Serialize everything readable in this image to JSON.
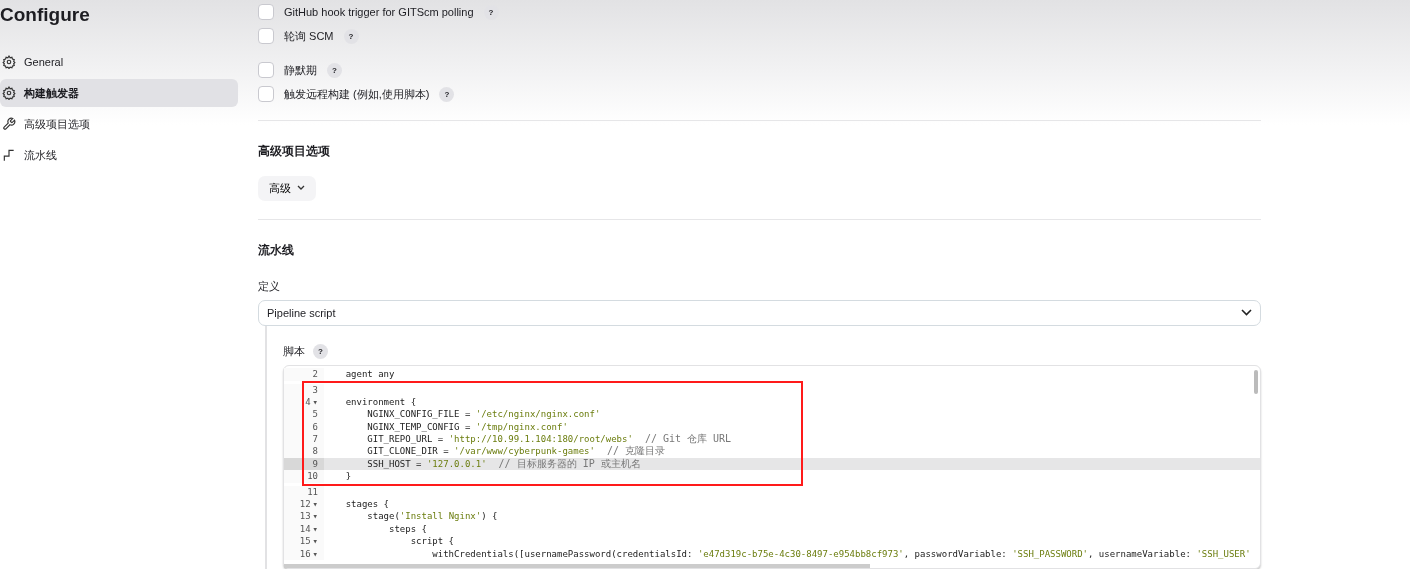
{
  "page_title": "Configure",
  "sidebar": {
    "items": [
      {
        "label": "General",
        "selected": false
      },
      {
        "label": "构建触发器",
        "selected": true
      },
      {
        "label": "高级项目选项",
        "selected": false
      },
      {
        "label": "流水线",
        "selected": false
      }
    ]
  },
  "triggers": [
    {
      "label": "GitHub hook trigger for GITScm polling",
      "checked": false
    },
    {
      "label": "轮询 SCM",
      "checked": false
    },
    {
      "label": "静默期",
      "checked": false
    },
    {
      "label": "触发远程构建 (例如,使用脚本)",
      "checked": false
    }
  ],
  "help_label": "?",
  "advanced_section": {
    "title": "高级项目选项",
    "button": "高级"
  },
  "pipeline_section": {
    "title": "流水线",
    "definition_label": "定义",
    "definition_value": "Pipeline script",
    "script_label": "脚本",
    "code_blocks": [
      {
        "highlighted": false,
        "lines": [
          {
            "number": "2",
            "active": false,
            "segments": [
              {
                "kind": "plain",
                "text": "    agent any"
              }
            ]
          }
        ]
      },
      {
        "highlighted": true,
        "lines": [
          {
            "number": "3",
            "active": false
          },
          {
            "number": "4",
            "fold": "▾",
            "active": false,
            "segments": [
              {
                "kind": "plain",
                "text": "    environment {"
              }
            ]
          },
          {
            "number": "5",
            "active": false,
            "segments": [
              {
                "kind": "plain",
                "text": "        NGINX_CONFIG_FILE = "
              },
              {
                "kind": "string",
                "text": "'/etc/nginx/nginx.conf'"
              }
            ]
          },
          {
            "number": "6",
            "active": false,
            "segments": [
              {
                "kind": "plain",
                "text": "        NGINX_TEMP_CONFIG = "
              },
              {
                "kind": "string",
                "text": "'/tmp/nginx.conf'"
              }
            ]
          },
          {
            "number": "7",
            "active": false,
            "segments": [
              {
                "kind": "plain",
                "text": "        GIT_REPO_URL = "
              },
              {
                "kind": "string",
                "text": "'http://10.99.1.104:180/root/webs'"
              },
              {
                "kind": "comment",
                "text": "  // Git 仓库 URL"
              }
            ]
          },
          {
            "number": "8",
            "active": false,
            "segments": [
              {
                "kind": "plain",
                "text": "        GIT_CLONE_DIR = "
              },
              {
                "kind": "string",
                "text": "'/var/www/cyberpunk-games'"
              },
              {
                "kind": "comment",
                "text": "  // 克隆目录"
              }
            ]
          },
          {
            "number": "9",
            "active": true,
            "segments": [
              {
                "kind": "plain",
                "text": "        SSH_HOST = "
              },
              {
                "kind": "string",
                "text": "'127.0.0.1'"
              },
              {
                "kind": "comment",
                "text": "  // 目标服务器的 IP 或主机名"
              }
            ]
          },
          {
            "number": "10",
            "active": false,
            "segments": [
              {
                "kind": "plain",
                "text": "    }"
              }
            ]
          }
        ]
      },
      {
        "highlighted": false,
        "lines": [
          {
            "number": "11",
            "active": false
          },
          {
            "number": "12",
            "fold": "▾",
            "active": false,
            "segments": [
              {
                "kind": "plain",
                "text": "    stages {"
              }
            ]
          },
          {
            "number": "13",
            "fold": "▾",
            "active": false,
            "segments": [
              {
                "kind": "plain",
                "text": "        stage("
              },
              {
                "kind": "string",
                "text": "'Install Nginx'"
              },
              {
                "kind": "plain",
                "text": ") {"
              }
            ]
          },
          {
            "number": "14",
            "fold": "▾",
            "active": false,
            "segments": [
              {
                "kind": "plain",
                "text": "            steps {"
              }
            ]
          },
          {
            "number": "15",
            "fold": "▾",
            "active": false,
            "segments": [
              {
                "kind": "plain",
                "text": "                script {"
              }
            ]
          },
          {
            "number": "16",
            "fold": "▾",
            "active": false,
            "segments": [
              {
                "kind": "plain",
                "text": "                    withCredentials([usernamePassword(credentialsId: "
              },
              {
                "kind": "string",
                "text": "'e47d319c-b75e-4c30-8497-e954bb8cf973'"
              },
              {
                "kind": "plain",
                "text": ", passwordVariable: "
              },
              {
                "kind": "string",
                "text": "'SSH_PASSWORD'"
              },
              {
                "kind": "plain",
                "text": ", usernameVariable: "
              },
              {
                "kind": "string",
                "text": "'SSH_USER'"
              }
            ]
          }
        ]
      }
    ]
  }
}
